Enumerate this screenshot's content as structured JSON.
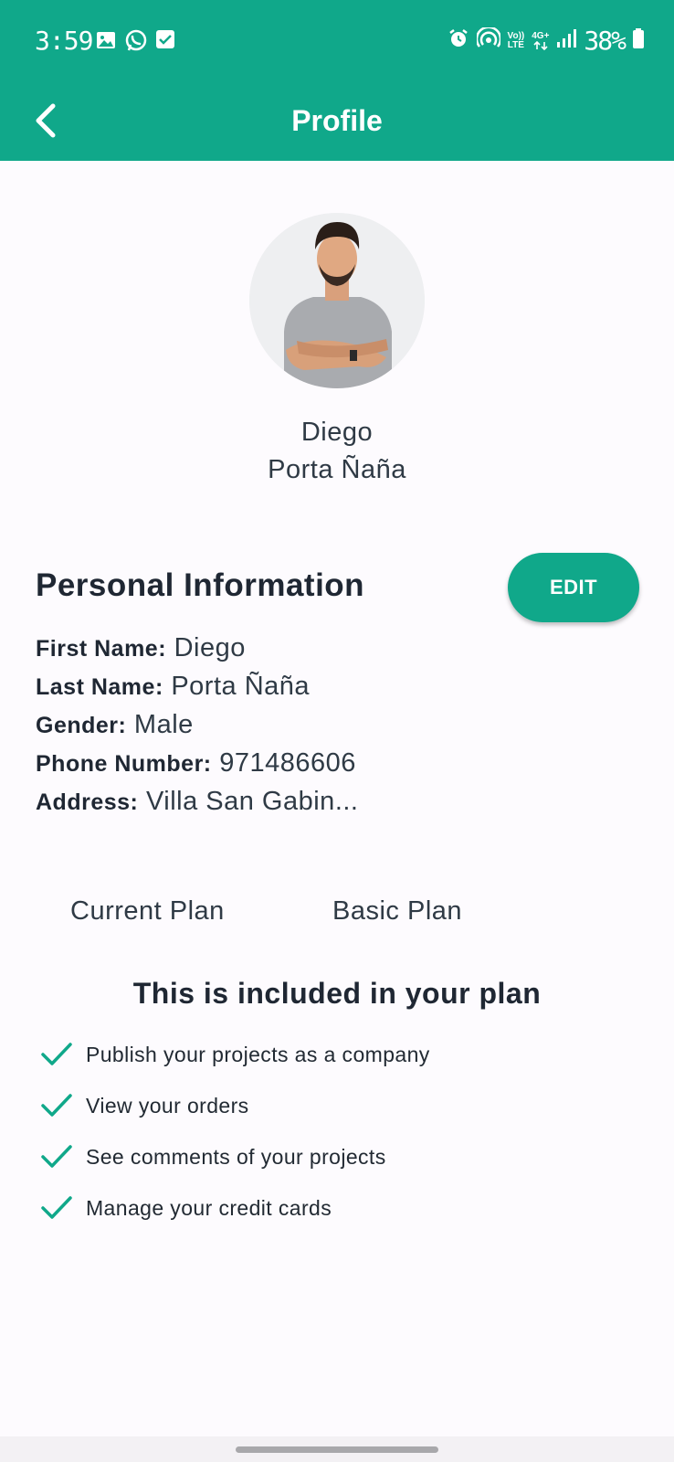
{
  "status_bar": {
    "time": "3:59",
    "battery": "38%",
    "network": "4G+",
    "volte_line1": "Vo))",
    "volte_line2": "LTE",
    "left_icons": [
      "gallery-icon",
      "whatsapp-icon",
      "checkbox-icon"
    ],
    "right_icons": [
      "alarm-icon",
      "hotspot-icon",
      "volte-icon",
      "4g-icon",
      "signal-icon",
      "battery-icon"
    ]
  },
  "appbar": {
    "title": "Profile",
    "back_icon": "chevron-left-icon"
  },
  "profile": {
    "first_name": "Diego",
    "last_name": "Porta Ñaña"
  },
  "personal_info": {
    "title": "Personal Information",
    "edit_label": "EDIT",
    "fields": [
      {
        "label": "First Name:",
        "value": "Diego"
      },
      {
        "label": "Last Name:",
        "value": "Porta Ñaña"
      },
      {
        "label": "Gender:",
        "value": "Male"
      },
      {
        "label": "Phone Number:",
        "value": "971486606"
      },
      {
        "label": "Address:",
        "value": "Villa San Gabin..."
      }
    ]
  },
  "plan": {
    "label": "Current Plan",
    "value": "Basic Plan",
    "included_title": "This is included in your plan",
    "features": [
      "Publish your projects as a company",
      "View your orders",
      "See comments of your projects",
      "Manage your credit cards"
    ]
  },
  "colors": {
    "accent": "#10a88a",
    "background": "#fdfbfe",
    "text_dark": "#1f2733"
  }
}
